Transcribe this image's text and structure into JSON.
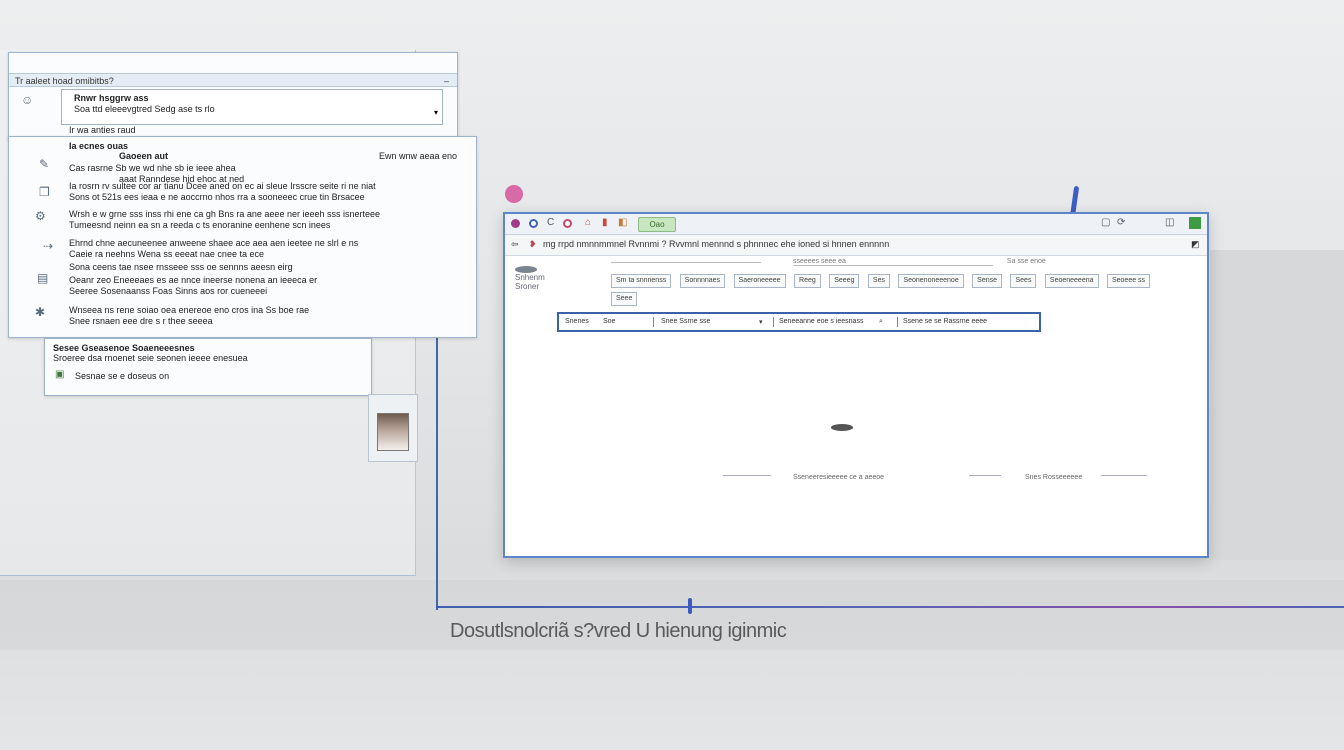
{
  "caption": "Dosutlsnolcriã s?vred  U hienung iginmic",
  "left_panel_a": {
    "title": "Tr aaleet hoad omibitbs?",
    "line1": "Rnwr hsggrw ass",
    "line2": "Soa ttd eleeevgtred Sedg ase ts rlo",
    "footer": "Ir wa anties raud"
  },
  "left_panel_b": {
    "rows": [
      {
        "l1": "Ia ecnes ouas",
        "l2": "Gaoeen aut",
        "right": "Ewn wnw aeaa eno"
      },
      {
        "l1": "Cas rasrne Sb we wd nhe sb ie ieee ahea",
        "l2": "aaat Ranndese hid ehoc at ned"
      },
      {
        "l1": "Ia rosrn rv sultee cor ar tianu Dcee aned on ec ai sleue Irsscre seite ri ne niat",
        "l2": "Sons ot 521s ees ieaa e ne aoccrno nhos rra a sooneeec crue tin Brsacee"
      },
      {
        "l1": "Wrsh e w grne sss inss rhi ene ca gh Bns ra ane aeee ner ieeeh sss isnerteee",
        "l2": "Tumeesnd neinn ea sn a reeda c ts enoranine eenhene scn inees"
      },
      {
        "l1": "Ehrnd chne aecuneenee anweene shaee ace aea aen ieetee ne slrl e ns",
        "l2": "Caeie ra neehns Wena ss eeeat nae cnee ta ece"
      },
      {
        "l1": "Sona ceens tae nsee rnsseee sss oe sennns aeesn eirg",
        "l2": ""
      },
      {
        "l1": "Oeanr zeo Eneeeaes es ae nnce ineerse nonena an ieeeca er",
        "l2": "Seeree Sosenaanss Foas Sinns aos ror cueneeei"
      },
      {
        "l1": "Wnseea ns rene soiao oea enereoe eno cros ina Ss boe rae",
        "l2": "Snee rsnaen eee dre s r thee seeea"
      }
    ],
    "icons": [
      "user-icon",
      "document-icon",
      "settings-icon",
      "folder-icon",
      "link-icon",
      "list-icon",
      "gear-icon"
    ]
  },
  "left_panel_c": {
    "line1": "Sesee Gseasenoe Soaeneeesnes",
    "line2": "Sroeree dsa rnoenet seie seonen ieeee enesuea",
    "line3": "Sesnae se e doseus on"
  },
  "browser": {
    "tab_label": "Oao",
    "toolbar_text": "mg rrpd nmnnmmnel Rvnnmi ?  Rvvmnl mennnd s phnnnec ehe ioned si hnnen ennnnn",
    "side_label_1": "Snhenm",
    "side_label_2": "Sroner",
    "input_left": "sseeees seee ea",
    "input_right": "Sa sse enoe",
    "filter_chips": [
      "Sm ta snnnenss",
      "Sonnnnaes",
      "Saeroneeeee",
      "Reeg",
      "Seeeg",
      "Ses",
      "Seonenoneeenoe",
      "Sense",
      "Sees",
      "Seoeneeeena",
      "Seoeee ss",
      "Seee"
    ],
    "search": {
      "field1_label": "Snenes",
      "field1_value": "Soe",
      "field2": "Snee Ssrne sse",
      "field3": "Seneeanne eoe s ieesnass",
      "field4": "Ssene se se Rassrne eeee"
    },
    "footer_left": "Sseneeresieeeee ce a aeeoe",
    "footer_right": "Snes Rosseeeeee"
  }
}
